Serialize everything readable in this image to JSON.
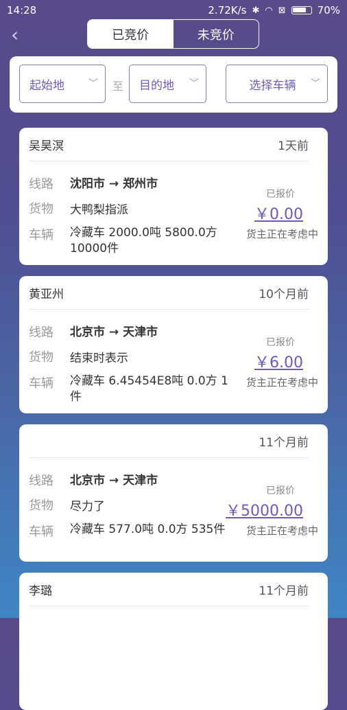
{
  "status_bar": {
    "time": "14:28",
    "speed": "2.72K/s",
    "battery_percent": "70%",
    "icons": [
      "bluetooth-icon",
      "wifi-icon",
      "sim-icon",
      "battery-icon"
    ]
  },
  "tabs": [
    {
      "label": "已竞价",
      "active": true
    },
    {
      "label": "未竞价",
      "active": false
    }
  ],
  "filters": {
    "origin": "起始地",
    "to": "至",
    "destination": "目的地",
    "vehicle": "选择车辆"
  },
  "labels": {
    "route": "线路",
    "cargo": "货物",
    "vehicle": "车辆",
    "bid": "已报价",
    "arrow": "→"
  },
  "cards": [
    {
      "name": "吴昊溟",
      "time": "1天前",
      "from": "沈阳市",
      "to": "郑州市",
      "cargo": "大鸭梨指派",
      "vehicle": "冷藏车  2000.0吨  5800.0方  10000件",
      "price": "￥0.00",
      "status": "货主正在考虑中"
    },
    {
      "name": "黄亚州",
      "time": "10个月前",
      "from": "北京市",
      "to": "天津市",
      "cargo": "结束时表示",
      "vehicle": "冷藏车  6.45454E8吨  0.0方  1件",
      "price": "￥6.00",
      "status": "货主正在考虑中"
    },
    {
      "name": "",
      "time": "11个月前",
      "from": "北京市",
      "to": "天津市",
      "cargo": "尽力了",
      "vehicle": "冷藏车  577.0吨  0.0方  535件",
      "price": "￥5000.00",
      "status": "货主正在考虑中"
    },
    {
      "name": "李璐",
      "time": "11个月前"
    }
  ]
}
